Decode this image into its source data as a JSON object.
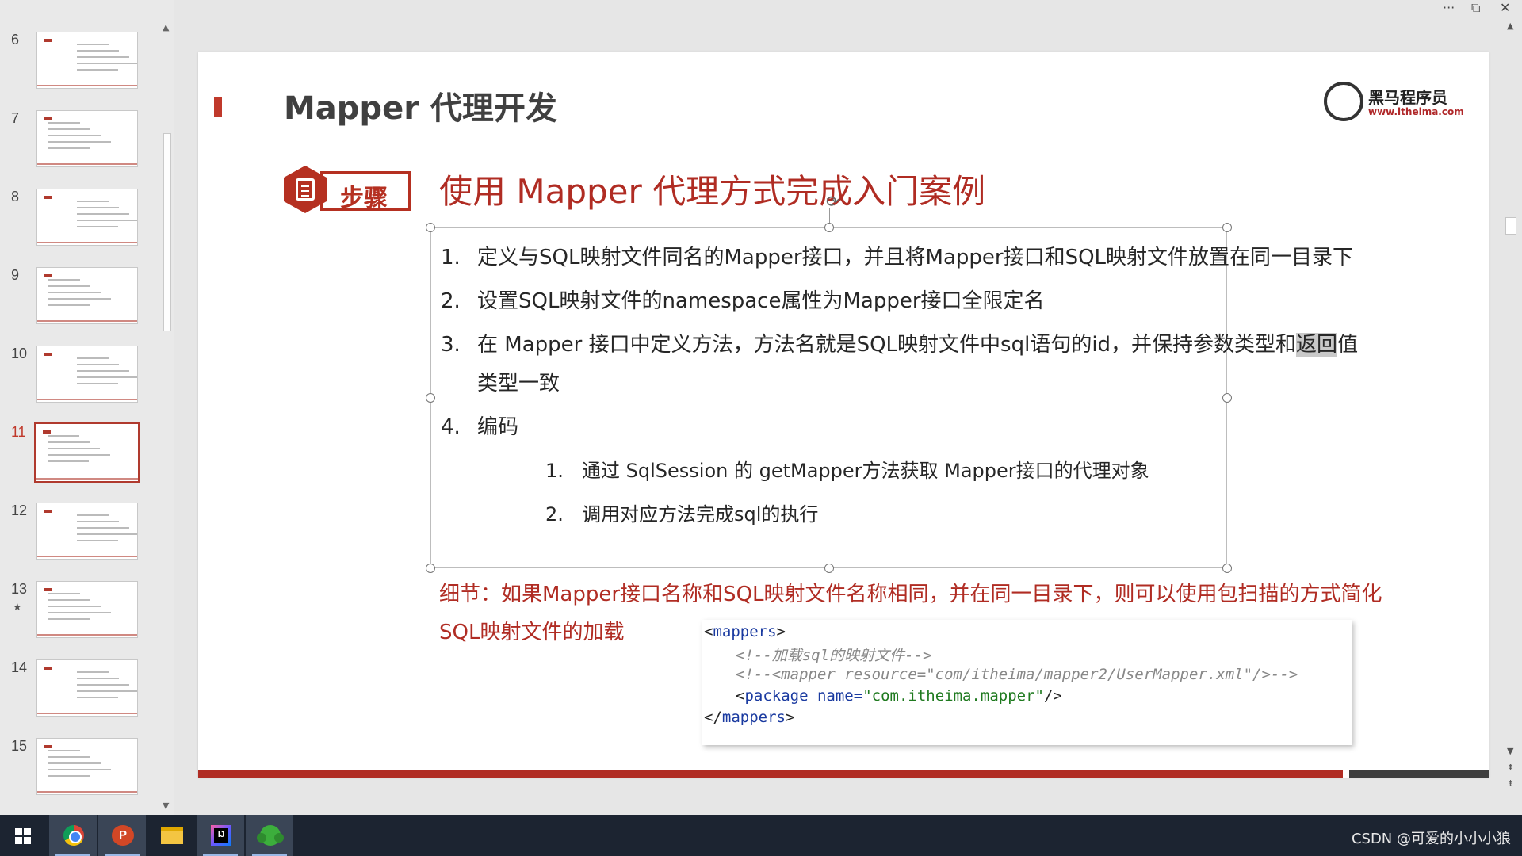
{
  "thumbnails": {
    "items": [
      {
        "number": "6",
        "starred": false
      },
      {
        "number": "7",
        "starred": false
      },
      {
        "number": "8",
        "starred": false
      },
      {
        "number": "9",
        "starred": false
      },
      {
        "number": "10",
        "starred": false
      },
      {
        "number": "11",
        "starred": false,
        "selected": true
      },
      {
        "number": "12",
        "starred": false
      },
      {
        "number": "13",
        "starred": true
      },
      {
        "number": "14",
        "starred": false
      },
      {
        "number": "15",
        "starred": false
      }
    ],
    "star_glyph": "★"
  },
  "slide": {
    "title": "Mapper 代理开发",
    "logo": {
      "name": "黑马程序员",
      "url": "www.itheima.com"
    },
    "step_label": "步骤",
    "heading": "使用 Mapper 代理方式完成入门案例",
    "items": [
      {
        "num": "1.",
        "text": "定义与SQL映射文件同名的Mapper接口，并且将Mapper接口和SQL映射文件放置在同一目录下"
      },
      {
        "num": "2.",
        "text": "设置SQL映射文件的namespace属性为Mapper接口全限定名"
      },
      {
        "num": "3.",
        "text_before": "在 Mapper 接口中定义方法，方法名就是SQL映射文件中sql语句的id，并保持参数类型和",
        "text_highlight": "返回",
        "text_after": "值",
        "text_line2": "类型一致"
      },
      {
        "num": "4.",
        "text": "编码"
      }
    ],
    "sub_items": [
      {
        "num": "1.",
        "text": "通过  SqlSession 的  getMapper方法获取  Mapper接口的代理对象"
      },
      {
        "num": "2.",
        "text": "调用对应方法完成sql的执行"
      }
    ],
    "detail_note": "细节：如果Mapper接口名称和SQL映射文件名称相同，并在同一目录下，则可以使用包扫描的方式简化SQL映射文件的加载",
    "code": {
      "open_tag": "mappers",
      "comment1": "<!--加载sql的映射文件-->",
      "comment2": "<!--<mapper resource=\"com/itheima/mapper2/UserMapper.xml\"/>-->",
      "package_tag": "package",
      "package_attr": "name=",
      "package_value": "\"com.itheima.mapper\"",
      "close_tag": "mappers"
    }
  },
  "window_controls": {
    "more": "···",
    "restore": "⧉",
    "close": "✕"
  },
  "scrollbar": {
    "up": "▲",
    "down": "▼",
    "prev": "⇞",
    "next": "⇟"
  },
  "taskbar": {
    "apps": [
      "windows-start",
      "chrome",
      "powerpoint",
      "file-explorer",
      "intellij-idea",
      "app"
    ],
    "ppt_letter": "P",
    "watermark": "CSDN @可爱的小小小狼"
  },
  "colors": {
    "accent_red": "#b02c23",
    "taskbar": "#1c2431"
  }
}
